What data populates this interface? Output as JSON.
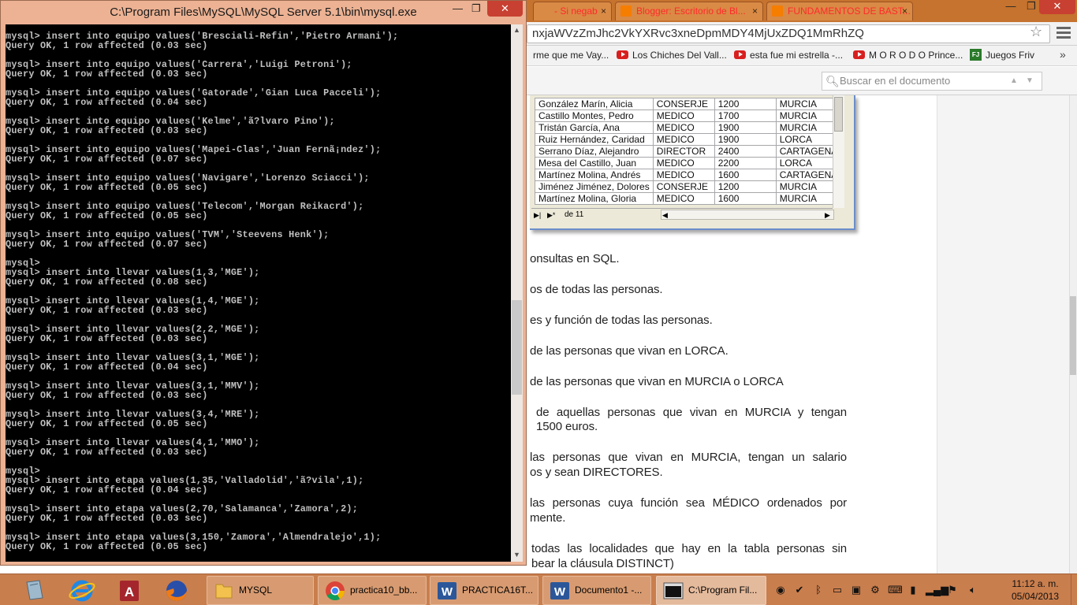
{
  "browser": {
    "tabs": [
      {
        "label": "- Si negab",
        "close": "×"
      },
      {
        "label": "Blogger: Escritorio de Bl...",
        "close": "×"
      },
      {
        "label": "FUNDAMENTOS DE BAST...",
        "close": "×"
      }
    ],
    "window_buttons": {
      "minimize": "—",
      "maximize": "❐",
      "close": "✕"
    },
    "url": "nxjaWVzZmJhc2VkYXRvc3xneDpmMDY4MjUxZDQ1MmRhZQ",
    "bookmarks": [
      {
        "label": "rme que me Vay..."
      },
      {
        "label": "Los Chiches Del Vall..."
      },
      {
        "label": "esta fue mi estrella -..."
      },
      {
        "label": "M O R O D O Prince..."
      },
      {
        "label": "Juegos Friv",
        "icon_text": "FJ"
      }
    ],
    "bookmarks_more": "»",
    "doc_search_placeholder": "Buscar en el documento",
    "datasheet": {
      "rows": [
        [
          "González Marín, Alicia",
          "CONSERJE",
          "1200",
          "MURCIA"
        ],
        [
          "Castillo Montes, Pedro",
          "MEDICO",
          "1700",
          "MURCIA"
        ],
        [
          "Tristán García, Ana",
          "MEDICO",
          "1900",
          "MURCIA"
        ],
        [
          "Ruiz Hernández, Caridad",
          "MEDICO",
          "1900",
          "LORCA"
        ],
        [
          "Serrano Díaz, Alejandro",
          "DIRECTOR",
          "2400",
          "CARTAGENA"
        ],
        [
          "Mesa del Castillo, Juan",
          "MEDICO",
          "2200",
          "LORCA"
        ],
        [
          "Martínez Molina, Andrés",
          "MEDICO",
          "1600",
          "CARTAGENA"
        ],
        [
          "Jiménez Jiménez, Dolores",
          "CONSERJE",
          "1200",
          "MURCIA"
        ],
        [
          "Martínez Molina, Gloria",
          "MEDICO",
          "1600",
          "MURCIA"
        ]
      ],
      "nav_record_text": "de  11"
    },
    "doc_lines": [
      "onsultas en SQL.",
      "os de todas las personas.",
      "es y función de todas las personas.",
      "de las personas que vivan en LORCA.",
      "de las personas que vivan en MURCIA o LORCA",
      "de aquellas personas que vivan en MURCIA y tengan",
      "1500 euros.",
      "las personas que vivan en MURCIA, tengan un salario",
      "os y sean DIRECTORES.",
      "las personas cuya función sea MÉDICO ordenados por",
      "mente.",
      "todas las localidades que hay en la tabla personas sin",
      "bear la cláusula DISTINCT)"
    ]
  },
  "console": {
    "title": "C:\\Program Files\\MySQL\\MySQL Server 5.1\\bin\\mysql.exe",
    "window_buttons": {
      "minimize": "—",
      "maximize": "❐",
      "close": "✕"
    },
    "lines": [
      "mysql> insert into equipo values('Bresciali-Refin','Pietro Armani');",
      "Query OK, 1 row affected (0.03 sec)",
      "",
      "mysql> insert into equipo values('Carrera','Luigi Petroni');",
      "Query OK, 1 row affected (0.03 sec)",
      "",
      "mysql> insert into equipo values('Gatorade','Gian Luca Pacceli');",
      "Query OK, 1 row affected (0.04 sec)",
      "",
      "mysql> insert into equipo values('Kelme','ã?lvaro Pino');",
      "Query OK, 1 row affected (0.03 sec)",
      "",
      "mysql> insert into equipo values('Mapei-Clas','Juan Fernã¡ndez');",
      "Query OK, 1 row affected (0.07 sec)",
      "",
      "mysql> insert into equipo values('Navigare','Lorenzo Sciacci');",
      "Query OK, 1 row affected (0.05 sec)",
      "",
      "mysql> insert into equipo values('Telecom','Morgan Reikacrd');",
      "Query OK, 1 row affected (0.05 sec)",
      "",
      "mysql> insert into equipo values('TVM','Steevens Henk');",
      "Query OK, 1 row affected (0.07 sec)",
      "",
      "mysql>",
      "mysql> insert into llevar values(1,3,'MGE');",
      "Query OK, 1 row affected (0.08 sec)",
      "",
      "mysql> insert into llevar values(1,4,'MGE');",
      "Query OK, 1 row affected (0.03 sec)",
      "",
      "mysql> insert into llevar values(2,2,'MGE');",
      "Query OK, 1 row affected (0.03 sec)",
      "",
      "mysql> insert into llevar values(3,1,'MGE');",
      "Query OK, 1 row affected (0.04 sec)",
      "",
      "mysql> insert into llevar values(3,1,'MMV');",
      "Query OK, 1 row affected (0.03 sec)",
      "",
      "mysql> insert into llevar values(3,4,'MRE');",
      "Query OK, 1 row affected (0.05 sec)",
      "",
      "mysql> insert into llevar values(4,1,'MMO');",
      "Query OK, 1 row affected (0.03 sec)",
      "",
      "mysql>",
      "mysql> insert into etapa values(1,35,'Valladolid','ã?vila',1);",
      "Query OK, 1 row affected (0.04 sec)",
      "",
      "mysql> insert into etapa values(2,70,'Salamanca','Zamora',2);",
      "Query OK, 1 row affected (0.03 sec)",
      "",
      "mysql> insert into etapa values(3,150,'Zamora','Almendralejo',1);",
      "Query OK, 1 row affected (0.05 sec)"
    ]
  },
  "taskbar": {
    "buttons": [
      {
        "label": "MYSQL"
      },
      {
        "label": "practica10_bb..."
      },
      {
        "label": "PRACTICA16T..."
      },
      {
        "label": "Documento1 -..."
      },
      {
        "label": "C:\\Program Fil..."
      }
    ],
    "clock_time": "11:12 a. m.",
    "clock_date": "05/04/2013"
  }
}
